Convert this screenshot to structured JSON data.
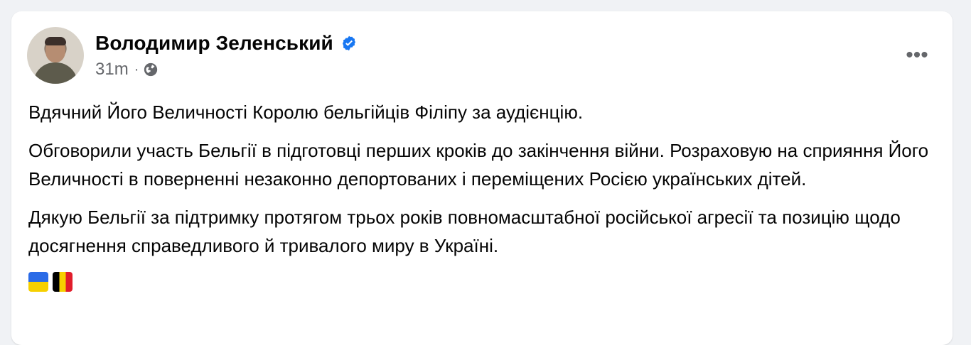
{
  "post": {
    "author": "Володимир Зеленський",
    "verified": true,
    "time": "31m",
    "visibility_icon": "globe-icon",
    "more_icon": "more-horizontal-icon",
    "paragraphs": [
      "Вдячний Його Величності Королю бельгійців Філіпу за аудієнцію.",
      "Обговорили участь Бельгії в підготовці перших кроків до закінчення війни. Розраховую на сприяння Його Величності в поверненні незаконно депортованих і переміщених Росією українських дітей.",
      "Дякую Бельгії за підтримку протягом трьох років повномасштабної російської агресії та позицію щодо досягнення справедливого й тривалого миру в Україні."
    ],
    "emoji": [
      "flag-ukraine",
      "flag-belgium"
    ]
  },
  "ui": {
    "verified_color": "#1877f2",
    "secondary_text": "#65676b"
  }
}
